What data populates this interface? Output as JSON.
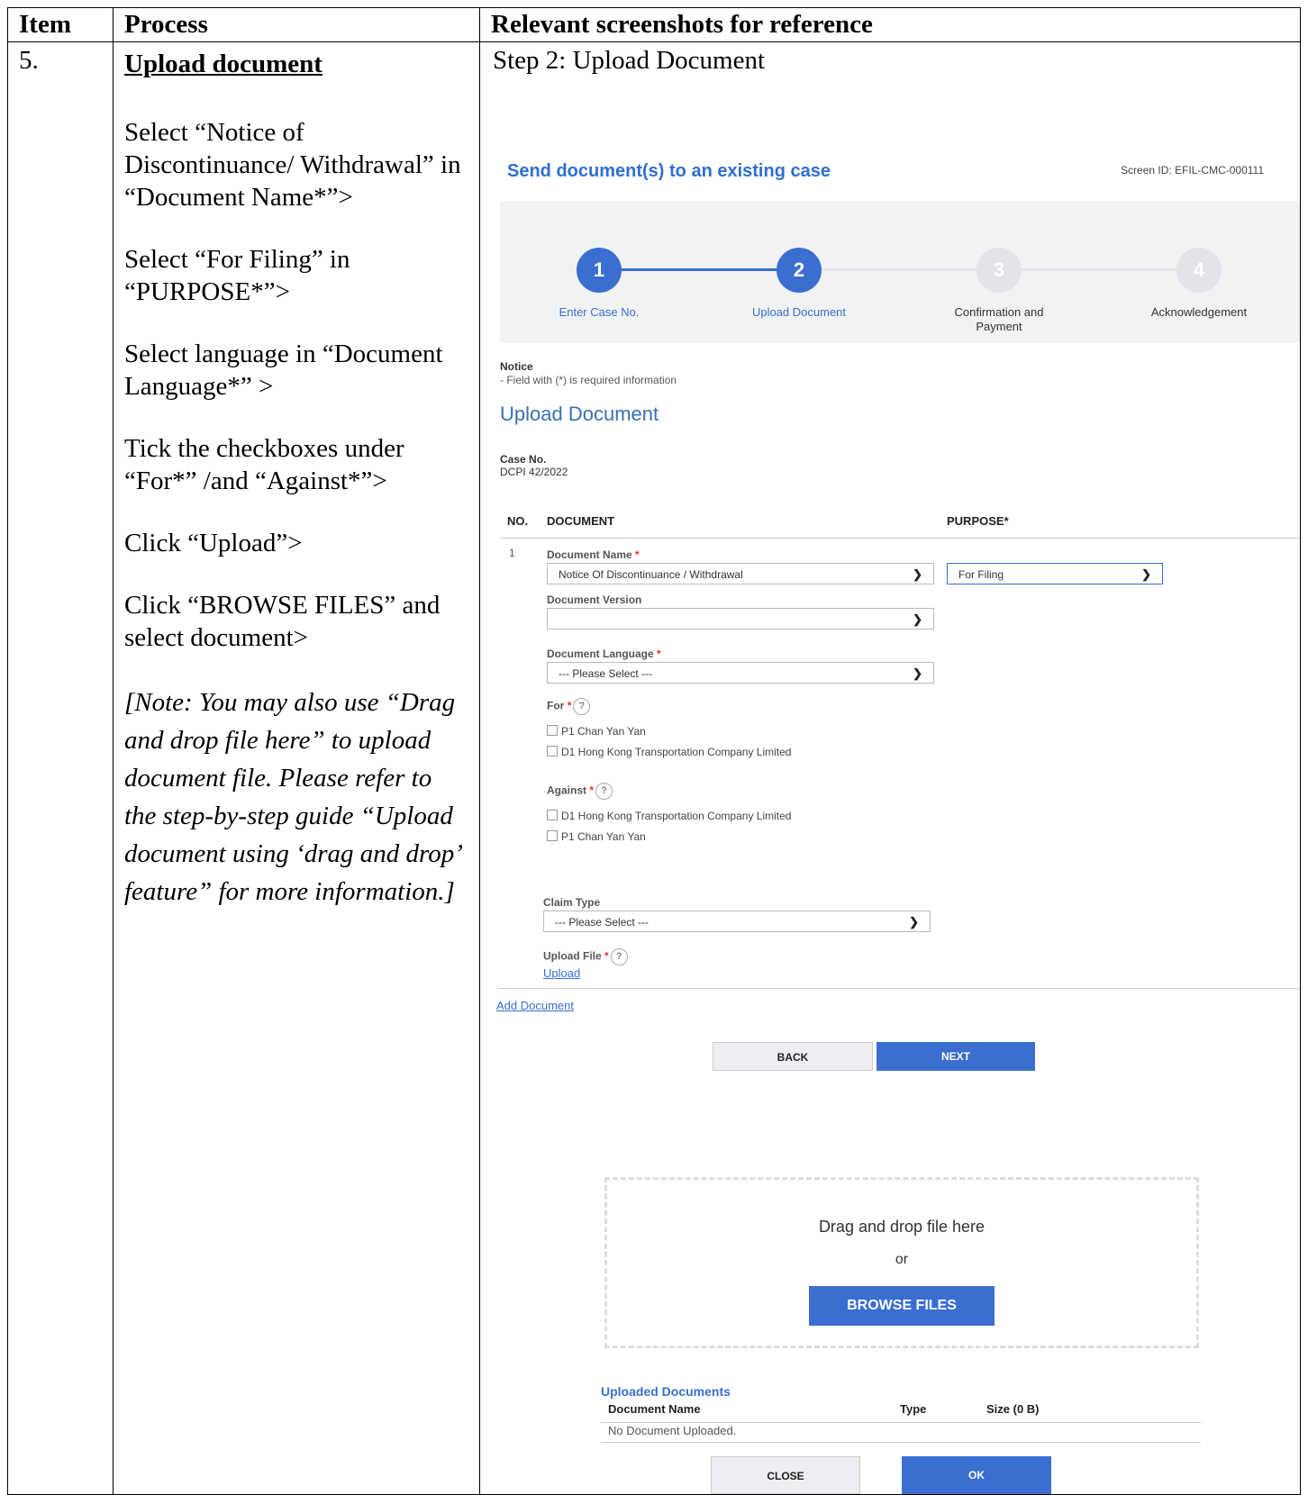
{
  "table": {
    "headers": {
      "item": "Item",
      "process": "Process",
      "reference": "Relevant screenshots for reference"
    },
    "row": {
      "item_no": "5.",
      "process": {
        "title": "Upload document",
        "steps": [
          "Select “Notice of Discontinuance/ Withdrawal” in “Document Name*”>",
          "Select “For Filing” in “PURPOSE*”>",
          "Select language in “Document Language*” >",
          "Tick the checkboxes under “For*” /and “Against*”>",
          "Click “Upload”>",
          "Click “BROWSE FILES” and select document>"
        ],
        "note": "[Note: You may also use “Drag and drop file here” to upload document file. Please refer to the step-by-step guide “Upload document using ‘drag and drop’ feature” for more information.]"
      },
      "reference_caption": "Step 2: Upload Document"
    }
  },
  "screen": {
    "title": "Send document(s) to an existing case",
    "screen_id": "Screen ID: EFIL-CMC-000111",
    "steps": [
      {
        "num": "1",
        "label": "Enter Case No."
      },
      {
        "num": "2",
        "label": "Upload Document"
      },
      {
        "num": "3",
        "label": "Confirmation and Payment"
      },
      {
        "num": "4",
        "label": "Acknowledgement"
      }
    ],
    "colors": {
      "accent": "#3a6ed0",
      "done": "#3a6ed0",
      "pending": "#e3e4e8"
    },
    "notice_heading": "Notice",
    "notice_text": "- Field with (*) is required information",
    "section_title": "Upload Document",
    "case_no_label": "Case No.",
    "case_no_value": "DCPI 42/2022",
    "columns": {
      "no": "NO.",
      "document": "DOCUMENT",
      "purpose": "PURPOSE*"
    },
    "row_no": "1",
    "document_name_label": "Document Name",
    "document_name_value": "Notice Of Discontinuance / Withdrawal",
    "purpose_value": "For Filing",
    "document_version_label": "Document Version",
    "document_version_value": "",
    "document_language_label": "Document Language",
    "document_language_value": "--- Please Select ---",
    "for_label": "For",
    "for_options": [
      "P1 Chan Yan Yan",
      "D1 Hong Kong Transportation Company Limited"
    ],
    "against_label": "Against",
    "against_options": [
      "D1 Hong Kong Transportation Company Limited",
      "P1 Chan Yan Yan"
    ],
    "claim_type_label": "Claim Type",
    "claim_type_value": "--- Please Select ---",
    "upload_file_label": "Upload File",
    "upload_link": "Upload",
    "add_document": "Add Document",
    "back": "BACK",
    "next": "NEXT",
    "required_mark": "*",
    "help_mark": "?",
    "dropzone": {
      "text": "Drag and drop file here",
      "or": "or",
      "browse": "BROWSE FILES"
    },
    "uploaded": {
      "heading": "Uploaded Documents",
      "columns": {
        "name": "Document Name",
        "type": "Type",
        "size": "Size (0 B)"
      },
      "empty": "No Document Uploaded."
    },
    "close": "CLOSE",
    "ok": "OK"
  }
}
